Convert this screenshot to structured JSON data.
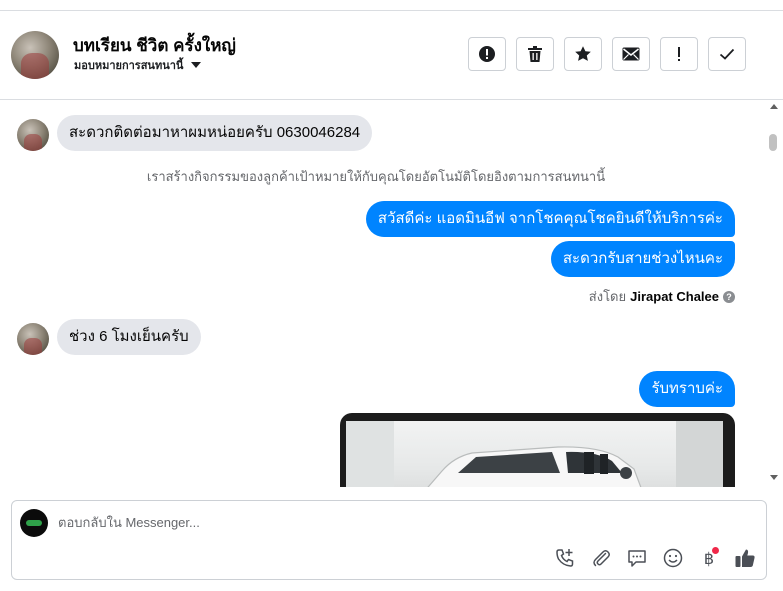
{
  "header": {
    "contact_name": "บทเรียน ชีวิต ครั้งใหญ่",
    "subtitle": "มอบหมายการสนทนานี้",
    "actions": [
      "report-icon",
      "trash-icon",
      "star-icon",
      "envelope-icon",
      "exclamation-icon",
      "check-icon"
    ]
  },
  "messages": {
    "m1": "สะดวกติดต่อมาหาผมหน่อยครับ 0630046284",
    "system_note": "เราสร้างกิจกรรมของลูกค้าเป้าหมายให้กับคุณโดยอัตโนมัติโดยอิงตามการสนทนานี้",
    "m2": "สวัสดีค่ะ แอดมินอีฟ จากโชคคุณโชคยินดีให้บริการค่ะ",
    "m3": "สะดวกรับสายช่วงไหนคะ",
    "sent_by_label": "ส่งโดย",
    "sent_by_name": "Jirapat Chalee",
    "help_glyph": "?",
    "m4": "ช่วง 6 โมงเย็นครับ",
    "m5": "รับทราบค่ะ"
  },
  "composer": {
    "placeholder": "ตอบกลับใน Messenger...",
    "tools": [
      "phone-add-icon",
      "paperclip-icon",
      "chat-bubble-icon",
      "smiley-icon",
      "baht-icon",
      "thumbs-up-icon"
    ],
    "baht_glyph": "฿"
  },
  "colors": {
    "accent": "#0084ff",
    "incoming_bubble": "#e4e6eb",
    "notification_dot": "#f02849"
  }
}
